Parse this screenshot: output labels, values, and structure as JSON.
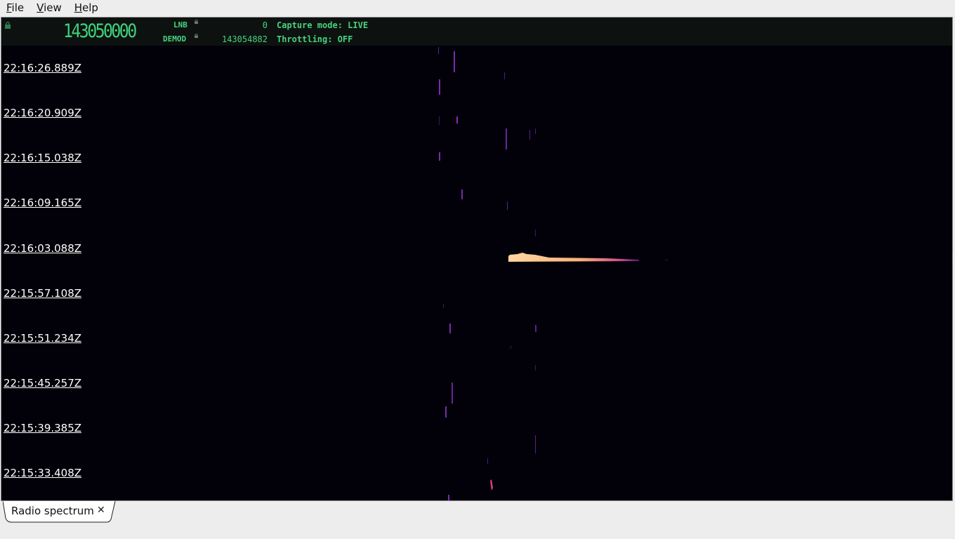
{
  "menu": {
    "file": {
      "mnemonic": "F",
      "rest": "ile"
    },
    "view": {
      "mnemonic": "V",
      "rest": "iew"
    },
    "help": {
      "mnemonic": "H",
      "rest": "elp"
    }
  },
  "infobar": {
    "main_frequency": "143050000",
    "lnb_label": "LNB",
    "lnb_value": "0",
    "demod_label": "DEMOD",
    "demod_value": "143054882",
    "capture_mode": "Capture mode: LIVE",
    "throttling": "Throttling: OFF"
  },
  "waterfall": {
    "timestamps": [
      "22:16:26.889Z",
      "22:16:20.909Z",
      "22:16:15.038Z",
      "22:16:09.165Z",
      "22:16:03.088Z",
      "22:15:57.108Z",
      "22:15:51.234Z",
      "22:15:45.257Z",
      "22:15:39.385Z",
      "22:15:33.408Z"
    ]
  },
  "tabs": [
    {
      "label": "Radio spectrum",
      "close_icon": "close-icon"
    }
  ],
  "colors": {
    "accent_green": "#49d17f",
    "waterfall_bg": "#020109",
    "signal_hot": "#f7c08a",
    "signal_cool": "#7a2bb0"
  }
}
